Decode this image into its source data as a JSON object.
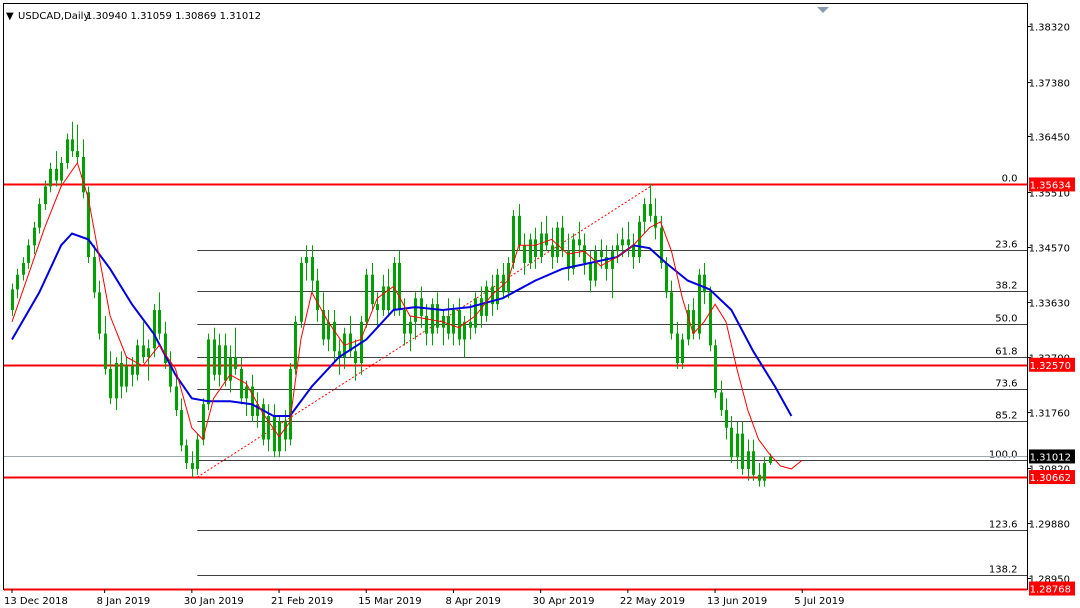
{
  "header": {
    "symbol": "USDCAD,Daily",
    "ohlc": "1.30940 1.31059 1.30869 1.31012"
  },
  "chart_data": {
    "type": "candlestick",
    "symbol": "USDCAD",
    "timeframe": "Daily",
    "ylim": [
      1.2876,
      1.387
    ],
    "y_ticks": [
      1.3832,
      1.3738,
      1.3645,
      1.3551,
      1.3457,
      1.3363,
      1.327,
      1.3176,
      1.3082,
      1.2988,
      1.2895
    ],
    "y_tick_labels": [
      "1.38320",
      "1.37380",
      "1.36450",
      "1.35510",
      "1.34570",
      "1.33630",
      "1.32700",
      "1.31760",
      "1.30820",
      "1.29880",
      "1.28950"
    ],
    "x_tick_labels": [
      "13 Dec 2018",
      "8 Jan 2019",
      "30 Jan 2019",
      "21 Feb 2019",
      "15 Mar 2019",
      "8 Apr 2019",
      "30 Apr 2019",
      "22 May 2019",
      "13 Jun 2019",
      "5 Jul 2019"
    ],
    "x_tick_index": [
      0,
      17,
      33,
      49,
      65,
      81,
      97,
      113,
      129,
      145
    ],
    "fib_start_index": 34,
    "fib_end_index": 157,
    "fib_levels": [
      {
        "label": "0.0",
        "value": 1.35634
      },
      {
        "label": "23.6",
        "value": 1.3452
      },
      {
        "label": "38.2",
        "value": 1.3383
      },
      {
        "label": "50.0",
        "value": 1.3326
      },
      {
        "label": "61.8",
        "value": 1.327
      },
      {
        "label": "73.6",
        "value": 1.3215
      },
      {
        "label": "85.2",
        "value": 1.3161
      },
      {
        "label": "100.0",
        "value": 1.3096
      },
      {
        "label": "123.6",
        "value": 1.2977
      },
      {
        "label": "138.2",
        "value": 1.2899
      }
    ],
    "fib_label_index": 179,
    "horizontal_levels": [
      {
        "value": 1.35634,
        "label": "1.35634"
      },
      {
        "value": 1.3257,
        "label": "1.32570"
      },
      {
        "value": 1.30662,
        "label": "1.30662"
      },
      {
        "value": 1.28768,
        "label": "1.28768"
      }
    ],
    "current_price": {
      "value": 1.31012,
      "label": "1.31012"
    },
    "trendline": {
      "from_index": 34,
      "from_value": 1.3066,
      "to_index": 118,
      "to_value": 1.3565
    },
    "candles": [
      [
        1.335,
        1.3395,
        1.334,
        1.3385
      ],
      [
        1.3385,
        1.342,
        1.337,
        1.341
      ],
      [
        1.341,
        1.344,
        1.34,
        1.343
      ],
      [
        1.343,
        1.347,
        1.342,
        1.346
      ],
      [
        1.346,
        1.35,
        1.3445,
        1.349
      ],
      [
        1.349,
        1.354,
        1.348,
        1.353
      ],
      [
        1.353,
        1.357,
        1.352,
        1.356
      ],
      [
        1.356,
        1.36,
        1.355,
        1.359
      ],
      [
        1.359,
        1.362,
        1.356,
        1.357
      ],
      [
        1.357,
        1.361,
        1.356,
        1.36
      ],
      [
        1.36,
        1.365,
        1.359,
        1.364
      ],
      [
        1.364,
        1.367,
        1.361,
        1.362
      ],
      [
        1.362,
        1.3665,
        1.36,
        1.361
      ],
      [
        1.361,
        1.364,
        1.354,
        1.355
      ],
      [
        1.355,
        1.356,
        1.343,
        1.344
      ],
      [
        1.344,
        1.346,
        1.337,
        1.338
      ],
      [
        1.338,
        1.34,
        1.33,
        1.331
      ],
      [
        1.331,
        1.334,
        1.324,
        1.325
      ],
      [
        1.325,
        1.328,
        1.319,
        1.32
      ],
      [
        1.32,
        1.327,
        1.318,
        1.326
      ],
      [
        1.326,
        1.328,
        1.32,
        1.322
      ],
      [
        1.322,
        1.327,
        1.321,
        1.3255
      ],
      [
        1.3255,
        1.327,
        1.322,
        1.324
      ],
      [
        1.324,
        1.33,
        1.323,
        1.329
      ],
      [
        1.329,
        1.333,
        1.326,
        1.327
      ],
      [
        1.327,
        1.33,
        1.323,
        1.3285
      ],
      [
        1.3285,
        1.336,
        1.327,
        1.335
      ],
      [
        1.335,
        1.338,
        1.33,
        1.331
      ],
      [
        1.331,
        1.333,
        1.325,
        1.326
      ],
      [
        1.326,
        1.328,
        1.321,
        1.322
      ],
      [
        1.322,
        1.324,
        1.317,
        1.318
      ],
      [
        1.318,
        1.32,
        1.311,
        1.312
      ],
      [
        1.312,
        1.313,
        1.308,
        1.309
      ],
      [
        1.309,
        1.311,
        1.3066,
        1.308
      ],
      [
        1.308,
        1.314,
        1.307,
        1.313
      ],
      [
        1.313,
        1.32,
        1.312,
        1.319
      ],
      [
        1.319,
        1.331,
        1.318,
        1.33
      ],
      [
        1.33,
        1.332,
        1.323,
        1.324
      ],
      [
        1.324,
        1.331,
        1.322,
        1.329
      ],
      [
        1.329,
        1.331,
        1.322,
        1.323
      ],
      [
        1.323,
        1.329,
        1.321,
        1.327
      ],
      [
        1.327,
        1.332,
        1.324,
        1.325
      ],
      [
        1.325,
        1.327,
        1.319,
        1.32
      ],
      [
        1.32,
        1.323,
        1.317,
        1.322
      ],
      [
        1.322,
        1.324,
        1.316,
        1.317
      ],
      [
        1.317,
        1.321,
        1.315,
        1.319
      ],
      [
        1.319,
        1.32,
        1.312,
        1.313
      ],
      [
        1.313,
        1.319,
        1.311,
        1.317
      ],
      [
        1.317,
        1.319,
        1.31,
        1.311
      ],
      [
        1.311,
        1.317,
        1.31,
        1.316
      ],
      [
        1.316,
        1.318,
        1.311,
        1.313
      ],
      [
        1.313,
        1.326,
        1.312,
        1.325
      ],
      [
        1.325,
        1.334,
        1.324,
        1.333
      ],
      [
        1.333,
        1.344,
        1.332,
        1.343
      ],
      [
        1.343,
        1.346,
        1.34,
        1.344
      ],
      [
        1.344,
        1.346,
        1.338,
        1.34
      ],
      [
        1.34,
        1.342,
        1.333,
        1.335
      ],
      [
        1.335,
        1.338,
        1.329,
        1.33
      ],
      [
        1.33,
        1.335,
        1.328,
        1.333
      ],
      [
        1.333,
        1.335,
        1.326,
        1.328
      ],
      [
        1.328,
        1.33,
        1.324,
        1.327
      ],
      [
        1.327,
        1.332,
        1.325,
        1.331
      ],
      [
        1.331,
        1.334,
        1.327,
        1.328
      ],
      [
        1.328,
        1.33,
        1.323,
        1.326
      ],
      [
        1.326,
        1.334,
        1.324,
        1.333
      ],
      [
        1.333,
        1.342,
        1.332,
        1.341
      ],
      [
        1.341,
        1.343,
        1.335,
        1.336
      ],
      [
        1.336,
        1.338,
        1.332,
        1.335
      ],
      [
        1.335,
        1.341,
        1.334,
        1.339
      ],
      [
        1.339,
        1.342,
        1.334,
        1.335
      ],
      [
        1.335,
        1.344,
        1.334,
        1.343
      ],
      [
        1.343,
        1.345,
        1.334,
        1.335
      ],
      [
        1.335,
        1.337,
        1.329,
        1.331
      ],
      [
        1.331,
        1.334,
        1.328,
        1.333
      ],
      [
        1.333,
        1.338,
        1.33,
        1.337
      ],
      [
        1.337,
        1.339,
        1.332,
        1.334
      ],
      [
        1.334,
        1.336,
        1.329,
        1.331
      ],
      [
        1.331,
        1.337,
        1.329,
        1.336
      ],
      [
        1.336,
        1.338,
        1.331,
        1.332
      ],
      [
        1.332,
        1.335,
        1.329,
        1.334
      ],
      [
        1.334,
        1.337,
        1.33,
        1.331
      ],
      [
        1.331,
        1.336,
        1.329,
        1.335
      ],
      [
        1.335,
        1.337,
        1.329,
        1.33
      ],
      [
        1.33,
        1.334,
        1.327,
        1.333
      ],
      [
        1.333,
        1.336,
        1.33,
        1.332
      ],
      [
        1.332,
        1.338,
        1.331,
        1.337
      ],
      [
        1.337,
        1.339,
        1.332,
        1.334
      ],
      [
        1.334,
        1.34,
        1.333,
        1.339
      ],
      [
        1.339,
        1.341,
        1.334,
        1.336
      ],
      [
        1.336,
        1.342,
        1.335,
        1.341
      ],
      [
        1.341,
        1.343,
        1.337,
        1.338
      ],
      [
        1.338,
        1.344,
        1.337,
        1.343
      ],
      [
        1.343,
        1.352,
        1.342,
        1.351
      ],
      [
        1.351,
        1.353,
        1.345,
        1.346
      ],
      [
        1.346,
        1.348,
        1.341,
        1.343
      ],
      [
        1.343,
        1.348,
        1.342,
        1.347
      ],
      [
        1.347,
        1.349,
        1.342,
        1.344
      ],
      [
        1.344,
        1.35,
        1.343,
        1.348
      ],
      [
        1.348,
        1.351,
        1.345,
        1.346
      ],
      [
        1.346,
        1.349,
        1.342,
        1.344
      ],
      [
        1.344,
        1.35,
        1.343,
        1.349
      ],
      [
        1.349,
        1.351,
        1.344,
        1.345
      ],
      [
        1.345,
        1.348,
        1.34,
        1.342
      ],
      [
        1.342,
        1.348,
        1.341,
        1.347
      ],
      [
        1.347,
        1.35,
        1.344,
        1.346
      ],
      [
        1.346,
        1.348,
        1.341,
        1.343
      ],
      [
        1.343,
        1.345,
        1.338,
        1.34
      ],
      [
        1.34,
        1.346,
        1.339,
        1.345
      ],
      [
        1.345,
        1.347,
        1.342,
        1.344
      ],
      [
        1.344,
        1.346,
        1.34,
        1.342
      ],
      [
        1.342,
        1.346,
        1.337,
        1.345
      ],
      [
        1.345,
        1.348,
        1.343,
        1.346
      ],
      [
        1.346,
        1.349,
        1.344,
        1.347
      ],
      [
        1.347,
        1.35,
        1.344,
        1.346
      ],
      [
        1.346,
        1.348,
        1.342,
        1.344
      ],
      [
        1.344,
        1.351,
        1.343,
        1.35
      ],
      [
        1.35,
        1.354,
        1.348,
        1.353
      ],
      [
        1.353,
        1.3565,
        1.35,
        1.351
      ],
      [
        1.351,
        1.354,
        1.347,
        1.349
      ],
      [
        1.349,
        1.351,
        1.342,
        1.343
      ],
      [
        1.343,
        1.344,
        1.337,
        1.338
      ],
      [
        1.338,
        1.34,
        1.33,
        1.331
      ],
      [
        1.331,
        1.333,
        1.325,
        1.326
      ],
      [
        1.326,
        1.331,
        1.325,
        1.33
      ],
      [
        1.33,
        1.336,
        1.329,
        1.335
      ],
      [
        1.335,
        1.337,
        1.33,
        1.331
      ],
      [
        1.331,
        1.342,
        1.33,
        1.341
      ],
      [
        1.341,
        1.343,
        1.336,
        1.338
      ],
      [
        1.338,
        1.339,
        1.328,
        1.329
      ],
      [
        1.329,
        1.33,
        1.32,
        1.321
      ],
      [
        1.321,
        1.323,
        1.317,
        1.318
      ],
      [
        1.318,
        1.32,
        1.313,
        1.315
      ],
      [
        1.315,
        1.317,
        1.309,
        1.31
      ],
      [
        1.31,
        1.316,
        1.308,
        1.314
      ],
      [
        1.314,
        1.316,
        1.307,
        1.308
      ],
      [
        1.308,
        1.313,
        1.306,
        1.311
      ],
      [
        1.311,
        1.313,
        1.306,
        1.307
      ],
      [
        1.307,
        1.309,
        1.305,
        1.306
      ],
      [
        1.306,
        1.31,
        1.305,
        1.309
      ],
      [
        1.309,
        1.3106,
        1.3087,
        1.3101
      ]
    ],
    "ema_fast": [
      [
        0,
        1.333
      ],
      [
        3,
        1.341
      ],
      [
        6,
        1.349
      ],
      [
        9,
        1.356
      ],
      [
        12,
        1.36
      ],
      [
        14,
        1.354
      ],
      [
        16,
        1.344
      ],
      [
        18,
        1.334
      ],
      [
        21,
        1.327
      ],
      [
        24,
        1.3255
      ],
      [
        27,
        1.329
      ],
      [
        30,
        1.325
      ],
      [
        33,
        1.315
      ],
      [
        35,
        1.313
      ],
      [
        37,
        1.32
      ],
      [
        40,
        1.324
      ],
      [
        43,
        1.3225
      ],
      [
        46,
        1.3175
      ],
      [
        49,
        1.3135
      ],
      [
        51,
        1.316
      ],
      [
        53,
        1.33
      ],
      [
        55,
        1.338
      ],
      [
        58,
        1.333
      ],
      [
        61,
        1.329
      ],
      [
        64,
        1.33
      ],
      [
        67,
        1.337
      ],
      [
        70,
        1.339
      ],
      [
        73,
        1.334
      ],
      [
        76,
        1.3335
      ],
      [
        79,
        1.333
      ],
      [
        82,
        1.332
      ],
      [
        85,
        1.334
      ],
      [
        88,
        1.3375
      ],
      [
        91,
        1.34
      ],
      [
        93,
        1.346
      ],
      [
        96,
        1.346
      ],
      [
        99,
        1.347
      ],
      [
        102,
        1.3445
      ],
      [
        105,
        1.345
      ],
      [
        108,
        1.3425
      ],
      [
        111,
        1.344
      ],
      [
        114,
        1.346
      ],
      [
        117,
        1.349
      ],
      [
        119,
        1.35
      ],
      [
        121,
        1.345
      ],
      [
        123,
        1.337
      ],
      [
        125,
        1.331
      ],
      [
        127,
        1.333
      ],
      [
        129,
        1.336
      ],
      [
        131,
        1.333
      ],
      [
        133,
        1.325
      ],
      [
        135,
        1.318
      ],
      [
        137,
        1.313
      ],
      [
        139,
        1.3105
      ],
      [
        141,
        1.3085
      ],
      [
        143,
        1.308
      ],
      [
        145,
        1.3095
      ]
    ],
    "sma_slow": [
      [
        0,
        1.33
      ],
      [
        5,
        1.338
      ],
      [
        9,
        1.346
      ],
      [
        11,
        1.348
      ],
      [
        14,
        1.347
      ],
      [
        18,
        1.342
      ],
      [
        22,
        1.336
      ],
      [
        26,
        1.331
      ],
      [
        30,
        1.324
      ],
      [
        33,
        1.32
      ],
      [
        36,
        1.3195
      ],
      [
        40,
        1.3195
      ],
      [
        44,
        1.319
      ],
      [
        48,
        1.317
      ],
      [
        51,
        1.317
      ],
      [
        55,
        1.322
      ],
      [
        60,
        1.327
      ],
      [
        65,
        1.33
      ],
      [
        70,
        1.335
      ],
      [
        74,
        1.3355
      ],
      [
        79,
        1.335
      ],
      [
        84,
        1.3355
      ],
      [
        90,
        1.337
      ],
      [
        96,
        1.34
      ],
      [
        101,
        1.342
      ],
      [
        106,
        1.343
      ],
      [
        111,
        1.344
      ],
      [
        114,
        1.346
      ],
      [
        117,
        1.3455
      ],
      [
        120,
        1.343
      ],
      [
        124,
        1.34
      ],
      [
        128,
        1.3385
      ],
      [
        132,
        1.335
      ],
      [
        136,
        1.328
      ],
      [
        140,
        1.322
      ],
      [
        143,
        1.317
      ]
    ],
    "up_color": "#00a000",
    "down_color": "#00a000",
    "ema_color": "#ff0000",
    "sma_color": "#0000dd",
    "level_color": "#ff0000",
    "fib_line_color": "#404040",
    "current_price_color": "#000000",
    "grid": false
  }
}
